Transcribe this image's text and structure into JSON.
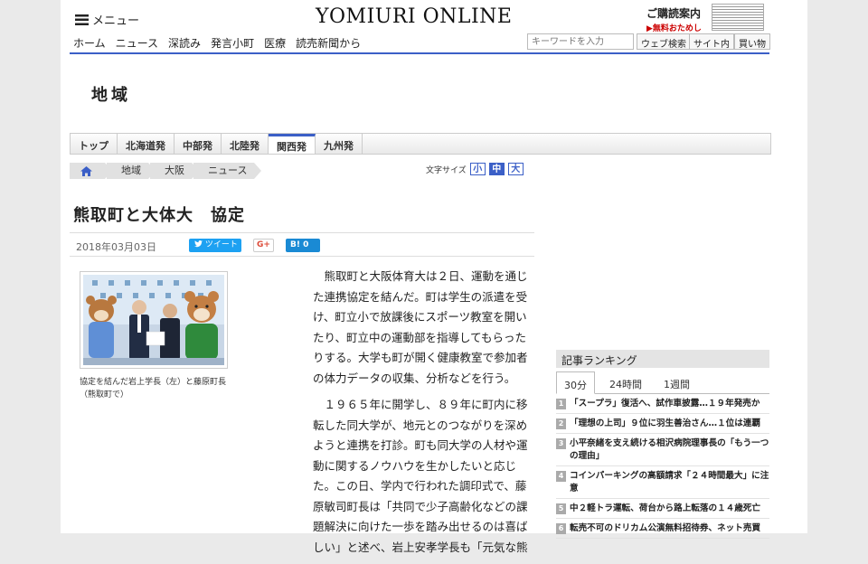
{
  "header": {
    "menu_label": "メニュー",
    "logo": "YOMIURI ONLINE",
    "subscribe_title": "ご購読案内",
    "subscribe_sub": "▶無料おためし",
    "nav": [
      "ホーム",
      "ニュース",
      "深読み",
      "発言小町",
      "医療",
      "読売新聞から"
    ],
    "search_placeholder": "キーワードを入力",
    "buttons": {
      "web": "ウェブ検索",
      "site": "サイト内",
      "shop": "買い物"
    }
  },
  "section": {
    "title": "地域"
  },
  "tabs": [
    {
      "label": "トップ",
      "active": false
    },
    {
      "label": "北海道発",
      "active": false
    },
    {
      "label": "中部発",
      "active": false
    },
    {
      "label": "北陸発",
      "active": false
    },
    {
      "label": "関西発",
      "active": true
    },
    {
      "label": "九州発",
      "active": false
    }
  ],
  "breadcrumb": [
    "地域",
    "大阪",
    "ニュース"
  ],
  "font_size": {
    "label": "文字サイズ",
    "options": [
      "小",
      "中",
      "大"
    ],
    "selected": "中"
  },
  "article": {
    "title": "熊取町と大体大　協定",
    "date": "2018年03月03日",
    "share": {
      "tweet": "ツイート",
      "gplus": "G+",
      "hatena": "B! 0"
    },
    "photo_caption": "協定を結んだ岩上学長（左）と藤原町長（熊取町で）",
    "paragraphs": [
      "熊取町と大阪体育大は２日、運動を通じた連携協定を結んだ。町は学生の派遣を受け、町立小で放課後にスポーツ教室を開いたり、町立中の運動部を指導してもらったりする。大学も町が開く健康教室で参加者の体力データの収集、分析などを行う。",
      "１９６５年に開学し、８９年に町内に移転した同大学が、地元とのつながりを深めようと連携を打診。町も同大学の人材や運動に関するノウハウを生かしたいと応じた。この日、学内で行われた調印式で、藤原敏司町長は「共同で少子高齢化などの課題解決に向けた一歩を踏み出せるのは喜ばしい」と述べ、岩上安孝学長も「元気な熊"
    ]
  },
  "ranking": {
    "heading": "記事ランキング",
    "tabs": [
      "30分",
      "24時間",
      "1週間"
    ],
    "active_tab": "30分",
    "items": [
      {
        "rank": "1",
        "text": "「スープラ」復活へ、試作車披露…１９年発売か"
      },
      {
        "rank": "2",
        "text": "「理想の上司」９位に羽生善治さん…１位は連覇"
      },
      {
        "rank": "3",
        "text": "小平奈緒を支え続ける相沢病院理事長の「もう一つの理由」"
      },
      {
        "rank": "4",
        "text": "コインパーキングの高額請求「２４時間最大」に注意"
      },
      {
        "rank": "5",
        "text": "中２軽トラ運転、荷台から路上転落の１４歳死亡"
      },
      {
        "rank": "6",
        "text": "転売不可のドリカム公演無料招待券、ネット売買"
      }
    ]
  },
  "colors": {
    "accent": "#3b5fc7",
    "twitter": "#1da1f2",
    "hatena": "#1a8ad4"
  }
}
